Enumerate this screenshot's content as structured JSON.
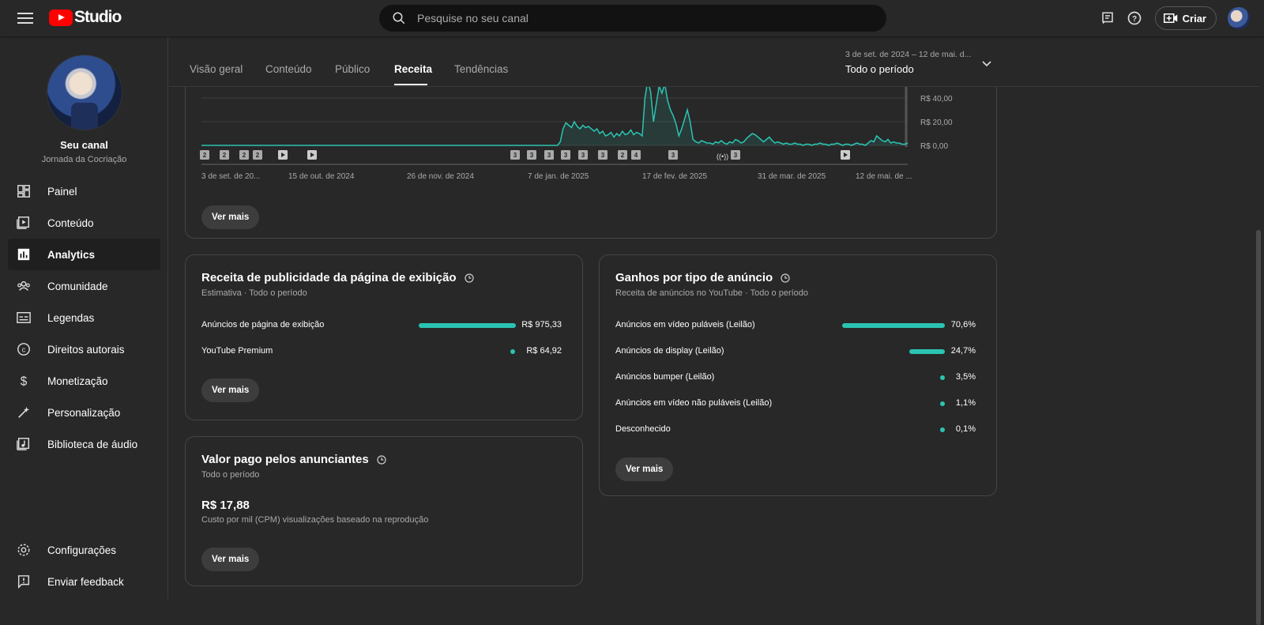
{
  "app": {
    "logo_text": "Studio"
  },
  "search": {
    "placeholder": "Pesquise no seu canal"
  },
  "topbar": {
    "create_label": "Criar"
  },
  "channel": {
    "name": "Seu canal",
    "subtitle": "Jornada da Cocriação"
  },
  "sidebar": {
    "items": [
      {
        "label": "Painel",
        "icon": "dashboard-icon"
      },
      {
        "label": "Conteúdo",
        "icon": "content-icon"
      },
      {
        "label": "Analytics",
        "icon": "analytics-icon",
        "active": true
      },
      {
        "label": "Comunidade",
        "icon": "community-icon"
      },
      {
        "label": "Legendas",
        "icon": "subtitles-icon"
      },
      {
        "label": "Direitos autorais",
        "icon": "copyright-icon"
      },
      {
        "label": "Monetização",
        "icon": "monetization-icon"
      },
      {
        "label": "Personalização",
        "icon": "customization-icon"
      },
      {
        "label": "Biblioteca de áudio",
        "icon": "audio-library-icon"
      }
    ],
    "bottom": [
      {
        "label": "Configurações",
        "icon": "settings-icon"
      },
      {
        "label": "Enviar feedback",
        "icon": "feedback-icon"
      }
    ]
  },
  "tabs": [
    {
      "label": "Visão geral"
    },
    {
      "label": "Conteúdo"
    },
    {
      "label": "Público"
    },
    {
      "label": "Receita",
      "active": true
    },
    {
      "label": "Tendências"
    }
  ],
  "period": {
    "range": "3 de set. de 2024 – 12 de mai. d...",
    "label": "Todo o período"
  },
  "chart_data": {
    "type": "area",
    "y_ticks": [
      "R$ 40,00",
      "R$ 20,00",
      "R$ 0,00"
    ],
    "x_ticks": [
      "3 de set. de 20...",
      "15 de out. de 2024",
      "26 de nov. de 2024",
      "7 de jan. de 2025",
      "17 de fev. de 2025",
      "31 de mar. de 2025",
      "12 de mai. de ..."
    ],
    "ylim": [
      0,
      40
    ],
    "series": [
      {
        "values": [
          0,
          0,
          0,
          0,
          0,
          0,
          0,
          0,
          0,
          0,
          0,
          0,
          0,
          0,
          0,
          0,
          0,
          0,
          0,
          0,
          0,
          0,
          0,
          0,
          0,
          0,
          0,
          0,
          0,
          0,
          0,
          0,
          0,
          0,
          0,
          0,
          0,
          0,
          0,
          0,
          0,
          0,
          0,
          0,
          0,
          0,
          0,
          0,
          0,
          0,
          0,
          0,
          0,
          0,
          0,
          0,
          0,
          0,
          0,
          0,
          0,
          0,
          0,
          0,
          0,
          0,
          0,
          0,
          0,
          0,
          0,
          0,
          0,
          0,
          0,
          0,
          0,
          0,
          0,
          0,
          0,
          0,
          0,
          0,
          0,
          0,
          0,
          0,
          0,
          0,
          0,
          0,
          0,
          0,
          0,
          0,
          0,
          0,
          0,
          0,
          0,
          0,
          0,
          0,
          0,
          0,
          0,
          0,
          0,
          0,
          0,
          0,
          0,
          0,
          0,
          0,
          0,
          0,
          0,
          0,
          0,
          0,
          0,
          0,
          0,
          0,
          0,
          3,
          14,
          19,
          17,
          15,
          20,
          16,
          14,
          17,
          15,
          16,
          14,
          12,
          14,
          10,
          12,
          8,
          9,
          11,
          7,
          10,
          8,
          12,
          9,
          10,
          13,
          9,
          11,
          10,
          8,
          40,
          55,
          45,
          20,
          35,
          50,
          44,
          52,
          38,
          30,
          25,
          18,
          8,
          14,
          22,
          30,
          20,
          5,
          3,
          2,
          4,
          3,
          2,
          2,
          1,
          3,
          2,
          4,
          2,
          1,
          3,
          2,
          5,
          4,
          2,
          3,
          6,
          8,
          10,
          9,
          7,
          5,
          3,
          5,
          7,
          4,
          2,
          3,
          2,
          1,
          2,
          1,
          1,
          2,
          1,
          1,
          0,
          1,
          1,
          0,
          1,
          1,
          2,
          1,
          1,
          0,
          1,
          1,
          2,
          1,
          0,
          1,
          1,
          0,
          1,
          2,
          1,
          1,
          0,
          2,
          4,
          3,
          8,
          6,
          4,
          3,
          5,
          2,
          3,
          2,
          2,
          1,
          1,
          2
        ]
      }
    ],
    "event_markers": [
      "2",
      "2",
      "2",
      "2",
      "play",
      "play",
      "3",
      "3",
      "3",
      "3",
      "3",
      "3",
      "2",
      "4",
      "3",
      "live",
      "3",
      "play"
    ]
  },
  "card_page": {
    "title": "Receita de publicidade da página de exibição",
    "subtitle": "Estimativa · Todo o período",
    "rows": [
      {
        "label": "Anúncios de página de exibição",
        "value": "R$ 975,33",
        "share": 0.938
      },
      {
        "label": "YouTube Premium",
        "value": "R$ 64,92",
        "share": 0.062
      }
    ],
    "button": "Ver mais"
  },
  "card_ads": {
    "title": "Ganhos por tipo de anúncio",
    "subtitle": "Receita de anúncios no YouTube · Todo o período",
    "rows": [
      {
        "label": "Anúncios em vídeo puláveis (Leilão)",
        "value": "70,6%",
        "share": 0.706
      },
      {
        "label": "Anúncios de display (Leilão)",
        "value": "24,7%",
        "share": 0.247
      },
      {
        "label": "Anúncios bumper (Leilão)",
        "value": "3,5%",
        "share": 0.035
      },
      {
        "label": "Anúncios em vídeo não puláveis (Leilão)",
        "value": "1,1%",
        "share": 0.011
      },
      {
        "label": "Desconhecido",
        "value": "0,1%",
        "share": 0.001
      }
    ],
    "button": "Ver mais"
  },
  "card_cpm": {
    "title": "Valor pago pelos anunciantes",
    "subtitle": "Todo o período",
    "value": "R$ 17,88",
    "description": "Custo por mil (CPM) visualizações baseado na reprodução",
    "button": "Ver mais"
  },
  "chart_button": "Ver mais",
  "colors": {
    "accent": "#2bc4b2",
    "background": "#282828"
  }
}
